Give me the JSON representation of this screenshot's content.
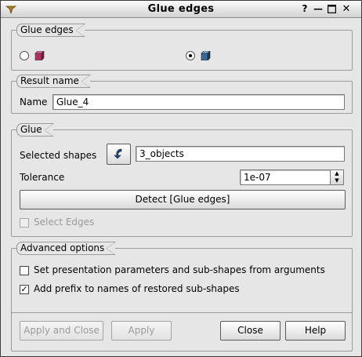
{
  "window": {
    "title": "Glue edges",
    "help_glyph": "?",
    "minimize_glyph": "—",
    "maximize_glyph": "☐",
    "close_glyph": "✕"
  },
  "glue_edges_group": {
    "title": "Glue edges",
    "options": [
      {
        "icon": "glue-faces-cube-icon",
        "selected": false
      },
      {
        "icon": "glue-edges-cube-icon",
        "selected": true
      }
    ]
  },
  "result_group": {
    "title": "Result name",
    "name_label": "Name",
    "name_value": "Glue_4"
  },
  "glue_group": {
    "title": "Glue",
    "selected_shapes_label": "Selected shapes",
    "selected_shapes_value": "3_objects",
    "tolerance_label": "Tolerance",
    "tolerance_value": "1e-07",
    "detect_button": "Detect [Glue edges]",
    "select_edges_label": "Select Edges",
    "select_edges_checked": false
  },
  "advanced_group": {
    "title": "Advanced options",
    "set_presentation_label": "Set presentation parameters and sub-shapes from arguments",
    "set_presentation_checked": false,
    "add_prefix_label": "Add prefix to names of restored sub-shapes",
    "add_prefix_checked": true
  },
  "buttons": {
    "apply_close": "Apply and Close",
    "apply": "Apply",
    "close": "Close",
    "help": "Help"
  },
  "colors": {
    "cube_face_1": "#b03060",
    "cube_face_2": "#3a6a9a"
  }
}
